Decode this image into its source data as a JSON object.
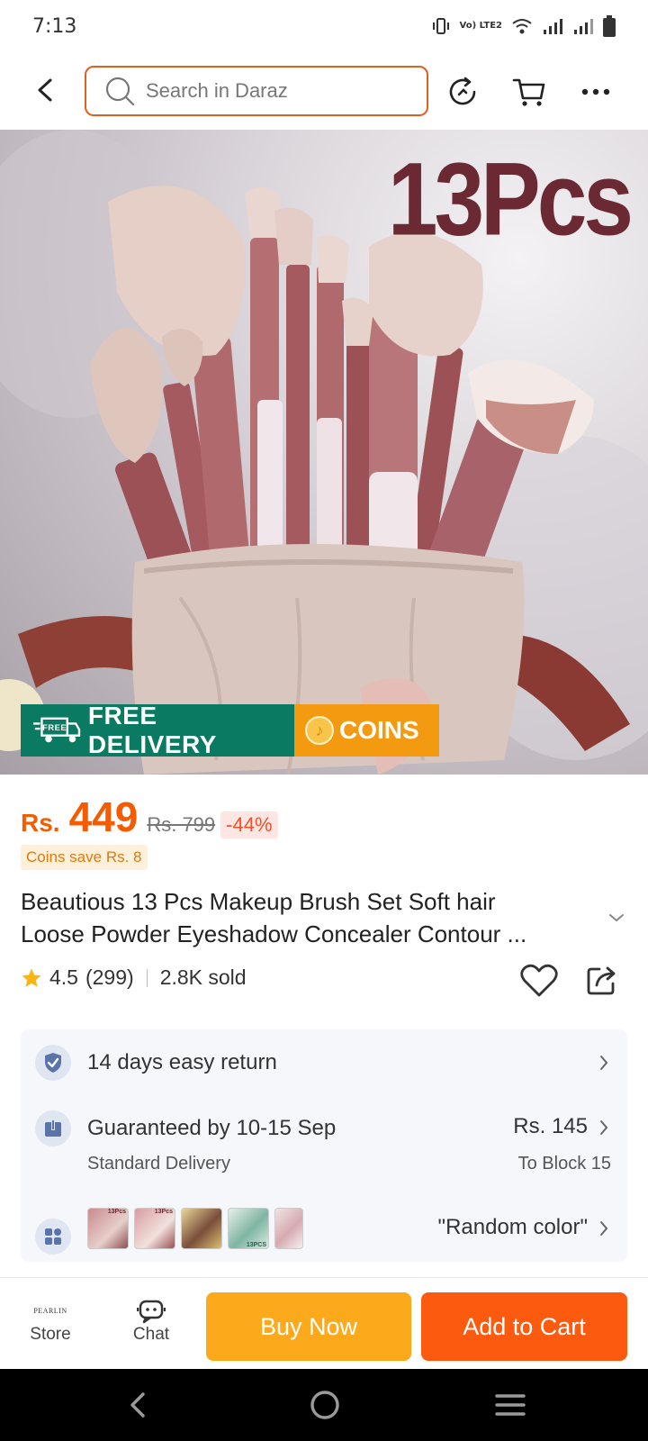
{
  "status_bar": {
    "time": "7:13",
    "volte": "Vo) LTE2"
  },
  "header": {
    "search_placeholder": "Search in Daraz"
  },
  "product_image": {
    "overlay_text": "13Pcs",
    "badge_free_delivery": "FREE DELIVERY",
    "badge_coins": "COINS",
    "truck_label": "FREE"
  },
  "price": {
    "currency": "Rs.",
    "current": "449",
    "original": "Rs. 799",
    "discount": "-44%",
    "coins_save": "Coins save Rs. 8"
  },
  "product": {
    "title_line1": "Beautious 13 Pcs Makeup Brush Set Soft hair",
    "title_line2": "Loose Powder Eyeshadow Concealer Contour ...",
    "rating": "4.5",
    "review_count": "(299)",
    "sold": "2.8K sold"
  },
  "info": {
    "return_text": "14 days easy return",
    "delivery_text": "Guaranteed by 10-15 Sep",
    "delivery_sub": "Standard Delivery",
    "delivery_price": "Rs. 145",
    "delivery_dest": "To Block 15",
    "variant_text": "\"Random color\"",
    "thumb_labels": [
      "13Pcs",
      "13Pcs",
      "",
      "13PCS",
      ""
    ]
  },
  "actions": {
    "store_logo": "PEARLIN",
    "store_label": "Store",
    "chat_label": "Chat",
    "buy_now": "Buy Now",
    "add_to_cart": "Add to Cart"
  },
  "colors": {
    "accent": "#f55b00",
    "buy": "#fcaa1c",
    "cart": "#fc5b0f",
    "free_delivery": "#0a7a62",
    "coins": "#f39a10",
    "search_border": "#e15f1f"
  },
  "icons": [
    "back-icon",
    "search-icon",
    "history-icon",
    "cart-icon",
    "more-icon",
    "truck-icon",
    "coin-icon",
    "chevron-down-icon",
    "star-icon",
    "heart-icon",
    "share-icon",
    "shield-icon",
    "delivery-icon",
    "variant-icon",
    "chevron-right-icon",
    "chat-icon",
    "nav-back-icon",
    "nav-home-icon",
    "nav-menu-icon"
  ]
}
